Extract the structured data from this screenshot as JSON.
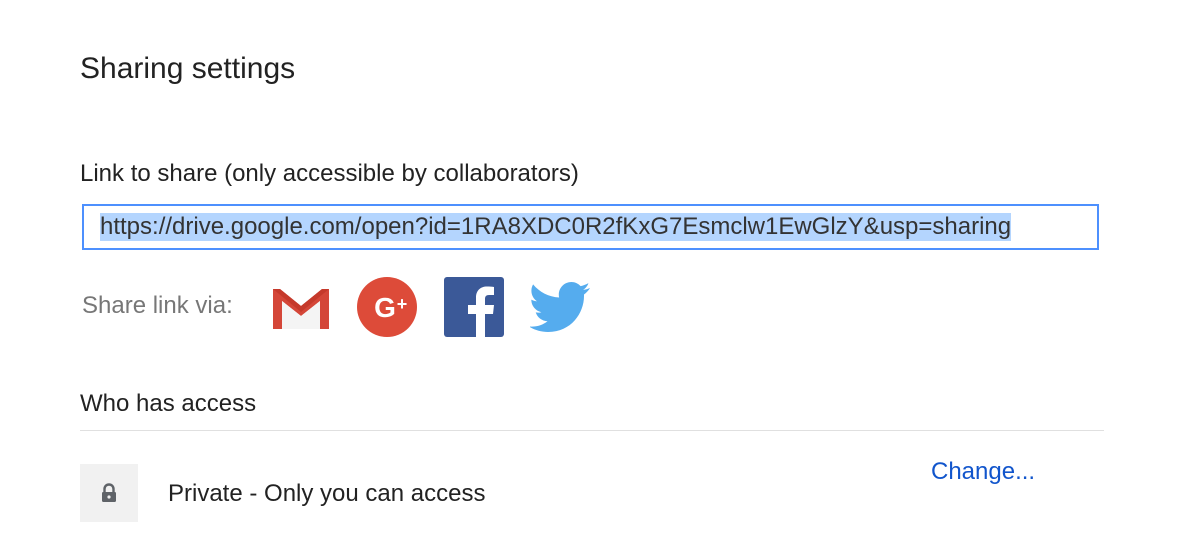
{
  "dialog": {
    "title": "Sharing settings"
  },
  "link_section": {
    "label": "Link to share (only accessible by collaborators)",
    "url": "https://drive.google.com/open?id=1RA8XDC0R2fKxG7Esmclw1EwGlzY&usp=sharing"
  },
  "share_via": {
    "label": "Share link via:",
    "services": [
      {
        "name": "Gmail",
        "icon": "gmail-icon",
        "color": "#d44638"
      },
      {
        "name": "Google+",
        "icon": "google-plus-icon",
        "color": "#dd4b39"
      },
      {
        "name": "Facebook",
        "icon": "facebook-icon",
        "color": "#3b5998"
      },
      {
        "name": "Twitter",
        "icon": "twitter-icon",
        "color": "#55acee"
      }
    ]
  },
  "access": {
    "heading": "Who has access",
    "entry_text": "Private - Only you can access",
    "entry_icon": "lock-icon",
    "change_label": "Change..."
  },
  "colors": {
    "link_border": "#4d90fe",
    "selection": "#b4d5fe",
    "link_blue": "#1155cc"
  }
}
